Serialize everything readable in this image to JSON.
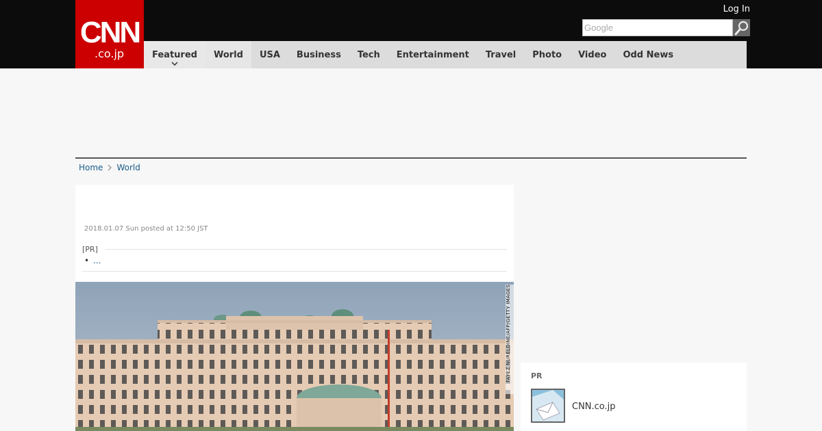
{
  "header": {
    "logo_main": "CNN",
    "logo_sub": ".co.jp",
    "login_label": "Log In",
    "search_placeholder": "Google",
    "brand_color": "#cc0000"
  },
  "nav": {
    "items": [
      "Featured",
      "World",
      "USA",
      "Business",
      "Tech",
      "Entertainment",
      "Travel",
      "Photo",
      "Video",
      "Odd News"
    ],
    "active": "World"
  },
  "breadcrumb": {
    "home": "Home",
    "current": "World"
  },
  "article": {
    "date": "2018.01.07 Sun posted at 12:50 JST",
    "pr_label": "[PR]",
    "pr_link": "...",
    "photo_credit": "FAYEZ NURELDINE/AFP/GETTY IMAGES"
  },
  "sidebar": {
    "pr_label": "PR",
    "pr_item_title": "CNN.co.jp"
  }
}
